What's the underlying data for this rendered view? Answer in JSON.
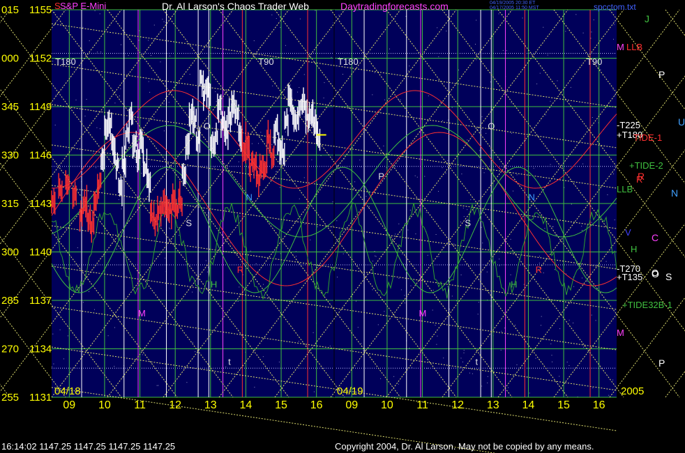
{
  "header": {
    "instrument": "S&P E-Mini",
    "instrument_prefix": "S",
    "title": "Dr. Al Larson's Chaos Trader Web",
    "site": "Daytradingforecasts.com",
    "stamp_line1": "04/19/2005 20:30 ET",
    "stamp_line2": "04/17/2005 11:50 MST",
    "file": "spcctom.txt"
  },
  "footer": {
    "status": "16:14:02  1147.25 1147.25 1147.25 1147.25",
    "copyright": "Copyright 2004, Dr. Al Larson. May not be copied by any means."
  },
  "colors": {
    "background": "#000000",
    "plot": "#00005a",
    "yellow": "#ffff00",
    "grid_green": "#40c040",
    "cross_lines": "#e0e070",
    "red": "#ff3030",
    "white": "#ffffff",
    "magenta": "#ff40ff",
    "cyan": "#40a0ff"
  },
  "chart_data": {
    "type": "line",
    "title": "S&P E-Mini",
    "ylim": [
      1131,
      1155
    ],
    "y_ticks": [
      {
        "deg": "015",
        "price": "1155",
        "value": 1155
      },
      {
        "deg": "000",
        "price": "1152",
        "value": 1152
      },
      {
        "deg": "345",
        "price": "1149",
        "value": 1149
      },
      {
        "deg": "330",
        "price": "1146",
        "value": 1146
      },
      {
        "deg": "315",
        "price": "1143",
        "value": 1143
      },
      {
        "deg": "300",
        "price": "1140",
        "value": 1140
      },
      {
        "deg": "285",
        "price": "1137",
        "value": 1137
      },
      {
        "deg": "270",
        "price": "1134",
        "value": 1134
      },
      {
        "deg": "255",
        "price": "1131",
        "value": 1131
      }
    ],
    "xlim": [
      8.5,
      16.5
    ],
    "days": [
      {
        "date": "04/18",
        "hours": [
          "09",
          "10",
          "11",
          "12",
          "13",
          "14",
          "15",
          "16"
        ]
      },
      {
        "date": "04/19",
        "hours": [
          "09",
          "10",
          "11",
          "12",
          "13",
          "14",
          "15",
          "16"
        ]
      }
    ],
    "year_label": "2005",
    "series": [
      {
        "name": "S&P E-Mini",
        "day": "04/18",
        "x": [
          8.5,
          8.7,
          8.9,
          9.1,
          9.3,
          9.4,
          9.5,
          9.6,
          9.7,
          9.8,
          9.9,
          10.0,
          10.1,
          10.2,
          10.3,
          10.4,
          10.5,
          10.6,
          10.7,
          10.8,
          10.9,
          11.0,
          11.1,
          11.2,
          11.3,
          11.4,
          11.5,
          11.6,
          11.7,
          11.8,
          11.9,
          12.0,
          12.1,
          12.2,
          12.3,
          12.4,
          12.5,
          12.6,
          12.7,
          12.8,
          12.9,
          13.0,
          13.1,
          13.2,
          13.3,
          13.4,
          13.5,
          13.6,
          13.7,
          13.8,
          13.9,
          14.0,
          14.1,
          14.2,
          14.3,
          14.4,
          14.5,
          14.6,
          14.7,
          14.8,
          14.9,
          15.0,
          15.1,
          15.2,
          15.3,
          15.4,
          15.5,
          15.6,
          15.7,
          15.8,
          15.9,
          16.0
        ],
        "y": [
          1143.2,
          1144.0,
          1144.2,
          1143.5,
          1142.5,
          1143.2,
          1142.0,
          1141.5,
          1143.0,
          1144.5,
          1145.8,
          1147.8,
          1148.0,
          1146.5,
          1145.5,
          1144.0,
          1145.5,
          1147.2,
          1148.5,
          1146.8,
          1146.0,
          1146.5,
          1145.2,
          1144.3,
          1142.5,
          1142.0,
          1142.6,
          1143.0,
          1142.8,
          1142.5,
          1143.0,
          1142.8,
          1143.2,
          1145.0,
          1146.8,
          1148.5,
          1148.0,
          1147.0,
          1150.5,
          1149.8,
          1150.0,
          1146.5,
          1147.0,
          1148.8,
          1148.0,
          1147.5,
          1148.4,
          1149.2,
          1148.5,
          1147.2,
          1146.5,
          1146.8,
          1145.5,
          1145.5,
          1144.5,
          1145.0,
          1145.5,
          1147.0,
          1146.0,
          1147.5,
          1146.5,
          1146.0,
          1148.0,
          1149.5,
          1148.5,
          1148.0,
          1149.0,
          1149.0,
          1148.5,
          1148.5,
          1148.2,
          1147.25
        ]
      }
    ],
    "last_price": 1147.25,
    "row_letters": [
      {
        "text": "J",
        "color": "#40c040"
      },
      {
        "text": "P",
        "color": "#ffffff"
      },
      {
        "text": "U",
        "color": "#40a0ff"
      },
      {
        "text": "R",
        "color": "#ff3030"
      },
      {
        "text": "N",
        "color": "#40a0ff"
      },
      {
        "text": "C",
        "color": "#ff40ff"
      },
      {
        "text": "O",
        "color": "#ffffff"
      },
      {
        "text": "S",
        "color": "#ffffff"
      },
      {
        "text": "P",
        "color": "#ffffff"
      }
    ],
    "line_labels": [
      {
        "text": "M",
        "color": "#ff40ff"
      },
      {
        "text": "LLB",
        "color": "#ff3030"
      },
      {
        "text": "-T225",
        "color": "#ffffff"
      },
      {
        "text": "+T180",
        "color": "#ffffff"
      },
      {
        "text": "TIDE-1",
        "color": "#ff3030"
      },
      {
        "text": "+TIDE-2",
        "color": "#40c040"
      },
      {
        "text": "R",
        "color": "#ff3030"
      },
      {
        "text": "LLB",
        "color": "#40c040"
      },
      {
        "text": "V",
        "color": "#4040ff"
      },
      {
        "text": "H",
        "color": "#40c040"
      },
      {
        "text": "-T270",
        "color": "#ffffff"
      },
      {
        "text": "O",
        "color": "#ffffff"
      },
      {
        "text": "+T135",
        "color": "#ffffff"
      },
      {
        "text": "+TIDE32B-1",
        "color": "#40c040"
      },
      {
        "text": "M",
        "color": "#ff40ff"
      }
    ],
    "in_plot_labels": [
      "T180",
      "T90",
      "T180",
      "T90",
      "O",
      "P",
      "O",
      "N",
      "N",
      "S",
      "S",
      "H",
      "H",
      "M",
      "M",
      "t",
      "t",
      "R",
      "R"
    ]
  }
}
